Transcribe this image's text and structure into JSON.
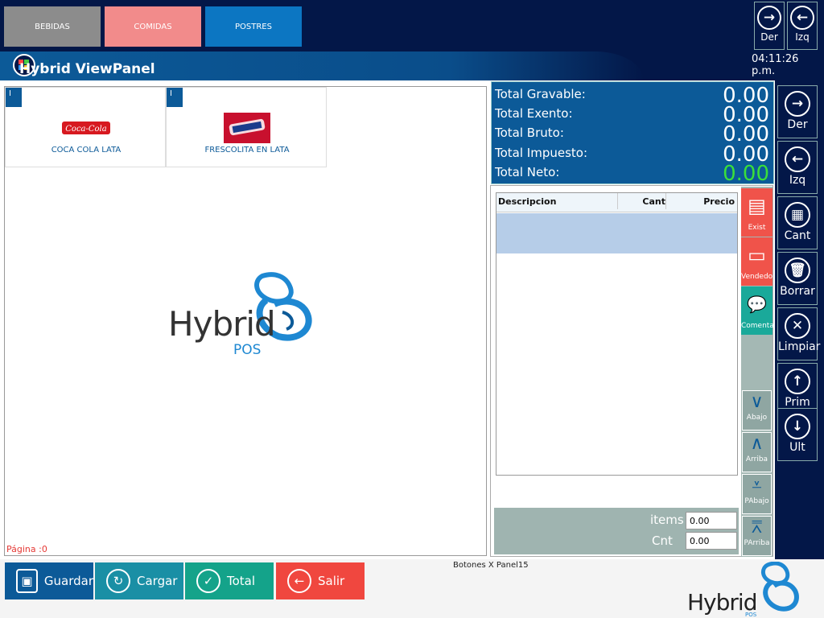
{
  "categories": [
    {
      "label": "BEBIDAS",
      "color": "#8c8c8c"
    },
    {
      "label": "COMIDAS",
      "color": "#f28b8b"
    },
    {
      "label": "POSTRES",
      "color": "#0c76c2"
    }
  ],
  "header": {
    "title": "Hybrid ViewPanel",
    "clock": "04:11:26 p.m."
  },
  "top_nav": {
    "der_label": "Der",
    "izq_label": "Izq"
  },
  "products": [
    {
      "tag": "I",
      "label": "COCA COLA LATA",
      "logo": "coca-cola-logo"
    },
    {
      "tag": "I",
      "label": "FRESCOLITA EN LATA",
      "logo": "frescolita-can-image"
    }
  ],
  "watermark": {
    "line1": "Hybrid",
    "line2": "POS"
  },
  "pagina": "Página :0",
  "totals": [
    {
      "label": "Total Gravable:",
      "value": "0.00"
    },
    {
      "label": "Total Exento:",
      "value": "0.00"
    },
    {
      "label": "Total Bruto:",
      "value": "0.00"
    },
    {
      "label": "Total Impuesto:",
      "value": "0.00"
    },
    {
      "label": "Total Neto:",
      "value": "0.00"
    }
  ],
  "grid": {
    "col_desc": "Descripcion",
    "col_cant": "Cant",
    "col_precio": "Precio"
  },
  "side_actions": [
    {
      "label": "Exist",
      "color": "#f0534a",
      "icon": "clipboard-icon"
    },
    {
      "label": "Vendedor",
      "color": "#f0534a",
      "icon": "briefcase-icon"
    },
    {
      "label": "Comenta",
      "color": "#1aa99a",
      "icon": "comment-icon"
    }
  ],
  "scroll_buttons": [
    {
      "label": "Abajo",
      "icon": "chevron-down-icon"
    },
    {
      "label": "Arriba",
      "icon": "chevron-up-icon"
    },
    {
      "label": "PAbajo",
      "icon": "page-down-icon"
    },
    {
      "label": "PArriba",
      "icon": "page-up-icon"
    }
  ],
  "summary": {
    "items_label": "items",
    "items_value": "0.00",
    "cnt_label": "Cnt",
    "cnt_value": "0.00"
  },
  "right_nav": [
    {
      "label": "Der",
      "icon": "arrow-right-icon"
    },
    {
      "label": "Izq",
      "icon": "arrow-left-icon"
    },
    {
      "label": "Cant",
      "icon": "calculator-icon"
    },
    {
      "label": "Borrar",
      "icon": "trash-icon"
    },
    {
      "label": "Limpiar",
      "icon": "clear-icon"
    },
    {
      "label": "Prim",
      "icon": "arrow-up-icon"
    },
    {
      "label": "Ult",
      "icon": "arrow-down-icon"
    }
  ],
  "actions": [
    {
      "label": "Guardar",
      "color": "#0c5a98",
      "icon": "save-icon"
    },
    {
      "label": "Cargar",
      "color": "#1a8fa5",
      "icon": "reload-icon"
    },
    {
      "label": "Total",
      "color": "#14a38a",
      "icon": "check-icon"
    },
    {
      "label": "Salir",
      "color": "#f0473f",
      "icon": "exit-icon"
    }
  ],
  "panel_name": "Botones X Panel15",
  "brand": {
    "line1": "Hybrid",
    "line2": "POS"
  },
  "colors": {
    "neto_value": "#3adf3a",
    "accent": "#0c5a98",
    "dark": "#031748"
  }
}
